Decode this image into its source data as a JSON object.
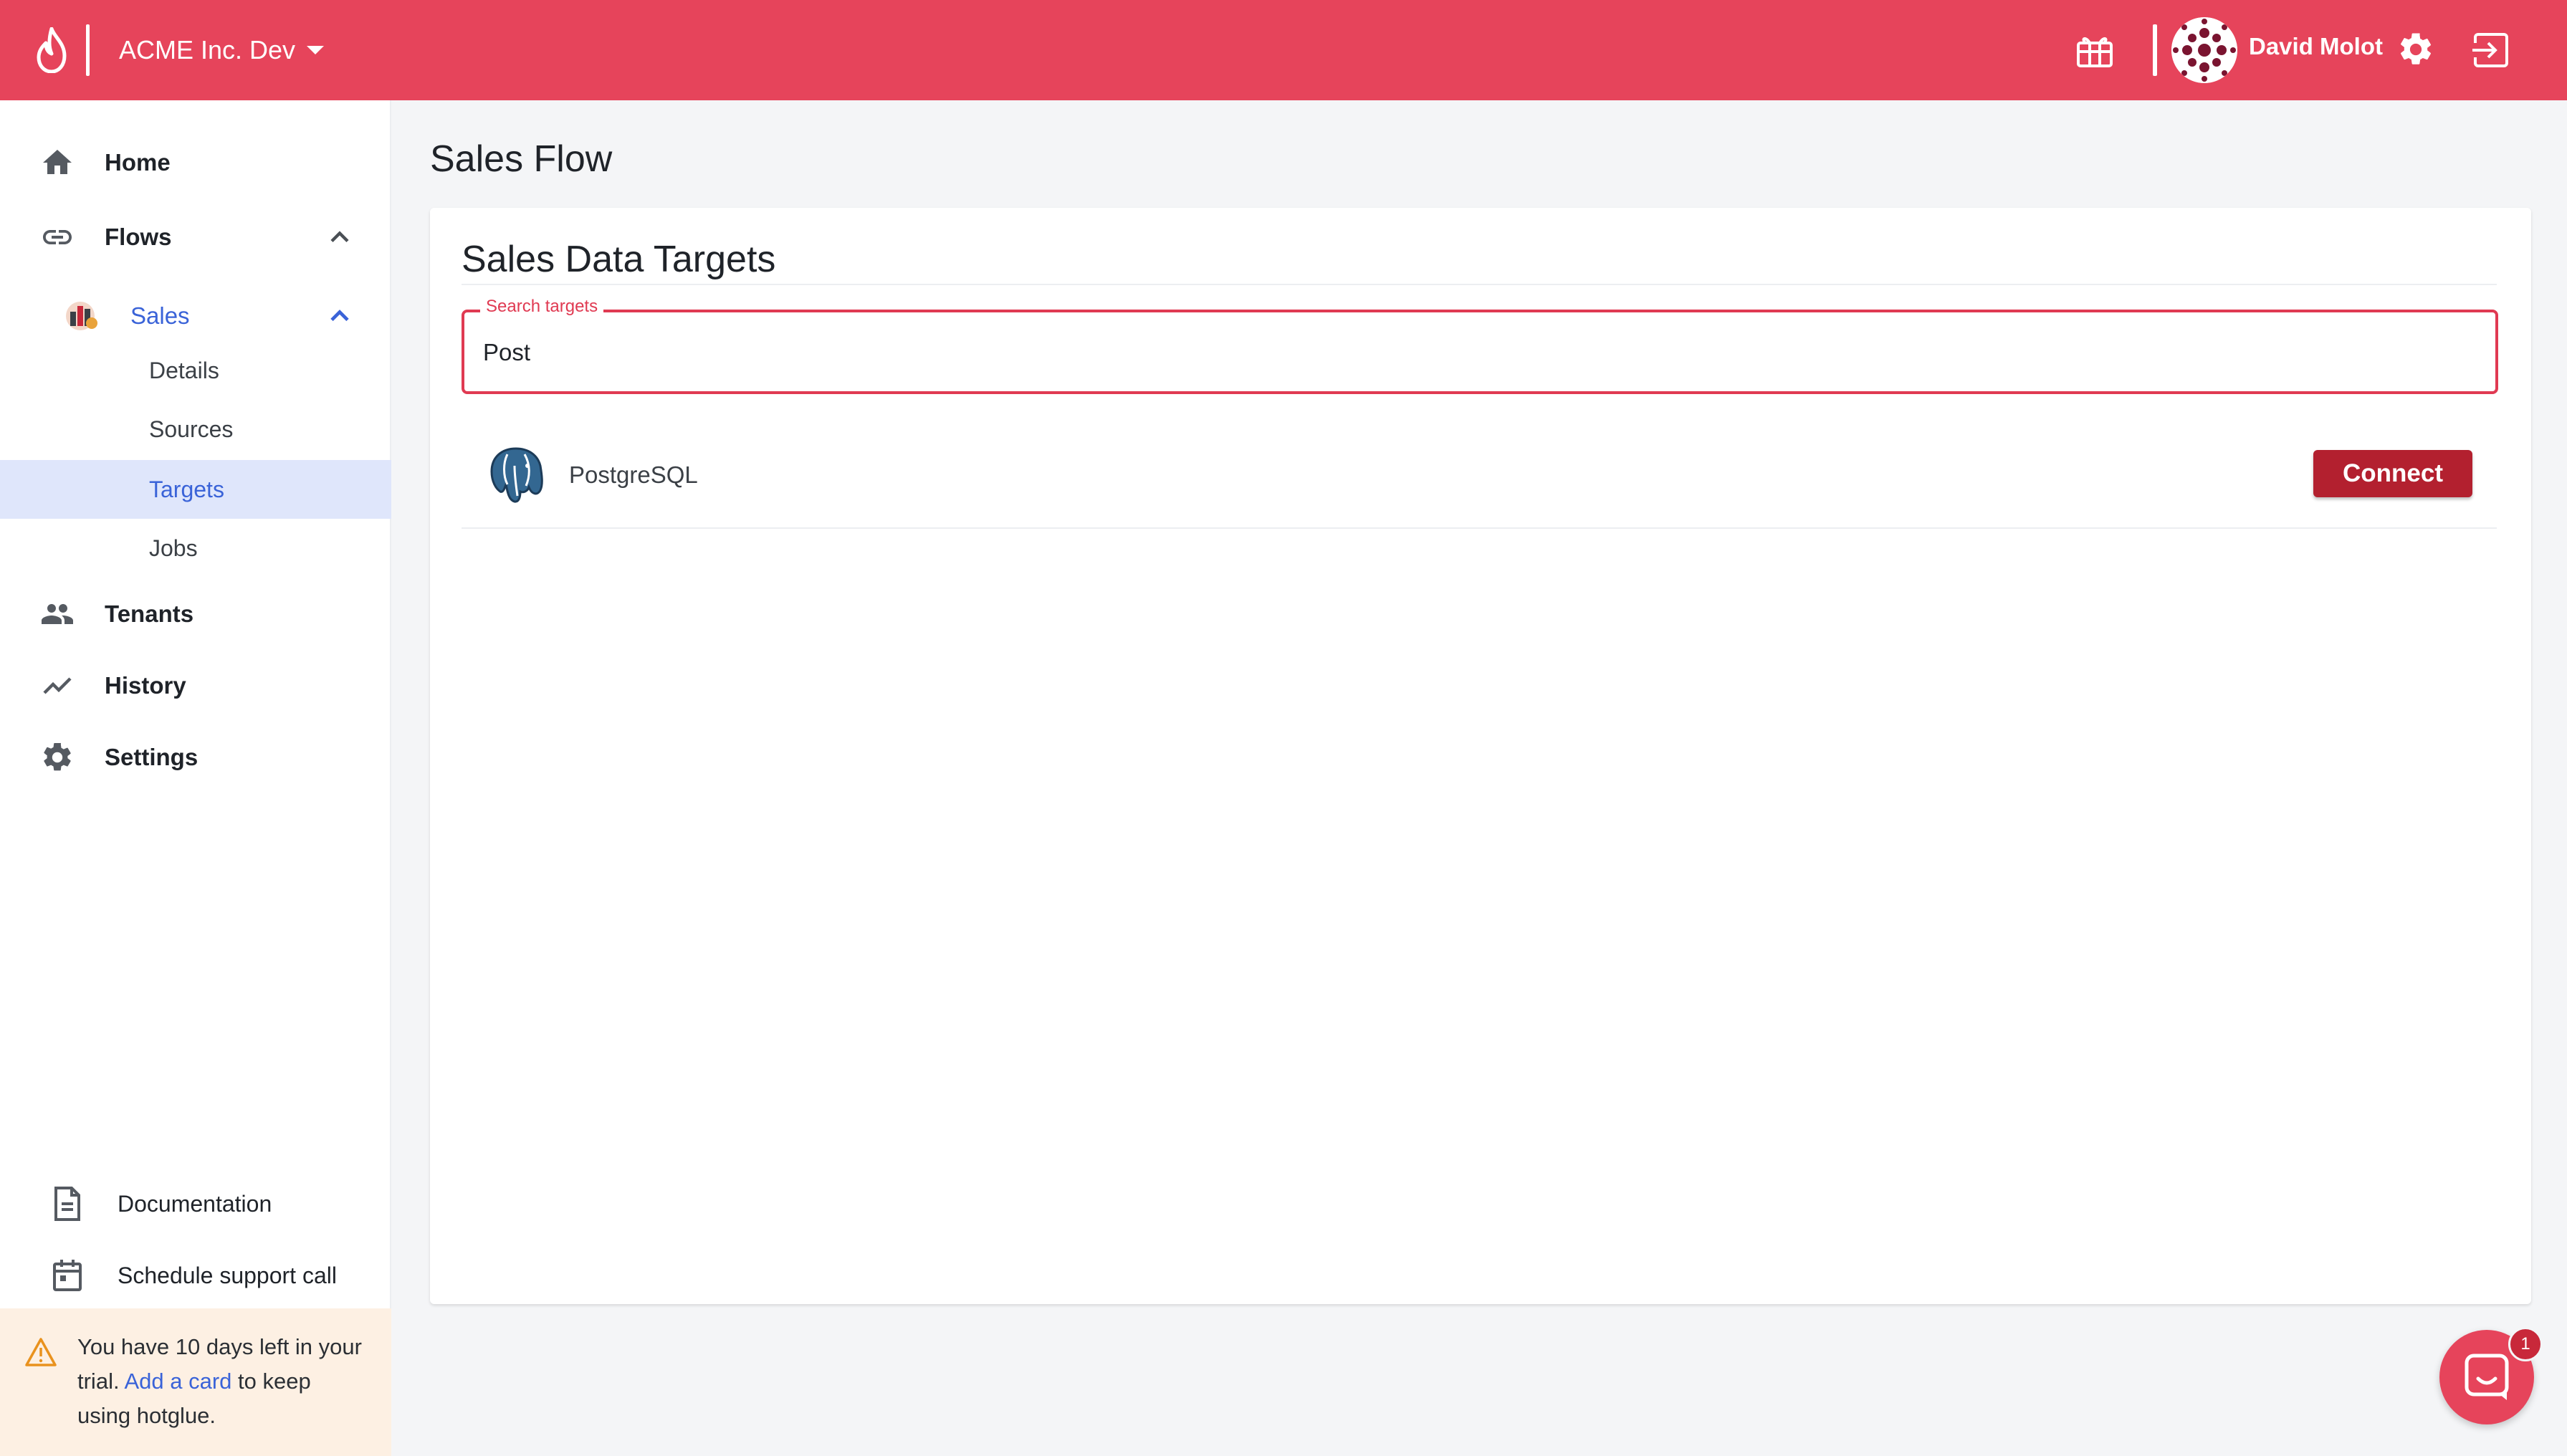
{
  "header": {
    "org_name": "ACME Inc. Dev",
    "user_name": "David Molot"
  },
  "sidebar": {
    "items": [
      {
        "label": "Home",
        "icon": "home-icon"
      },
      {
        "label": "Flows",
        "icon": "link-icon"
      },
      {
        "label": "Tenants",
        "icon": "people-icon"
      },
      {
        "label": "History",
        "icon": "trending-icon"
      },
      {
        "label": "Settings",
        "icon": "gear-icon"
      }
    ],
    "flow": {
      "label": "Sales",
      "subitems": [
        "Details",
        "Sources",
        "Targets",
        "Jobs"
      ],
      "active": "Targets"
    },
    "bottom_links": [
      {
        "label": "Documentation",
        "icon": "document-icon"
      },
      {
        "label": "Schedule support call",
        "icon": "calendar-icon"
      }
    ],
    "trial": {
      "prefix": "You have 10 days left in your trial. ",
      "link": "Add a card",
      "suffix": " to keep using hotglue."
    }
  },
  "main": {
    "page_title": "Sales Flow",
    "card_title": "Sales Data Targets",
    "search": {
      "label": "Search targets",
      "value": "Post"
    },
    "results": [
      {
        "name": "PostgreSQL",
        "icon": "postgresql-icon",
        "action": "Connect"
      }
    ]
  },
  "chat": {
    "badge_count": "1"
  },
  "colors": {
    "brand": "#e6445b",
    "active_blue": "#3a63d8",
    "connect_button": "#b3202f"
  }
}
